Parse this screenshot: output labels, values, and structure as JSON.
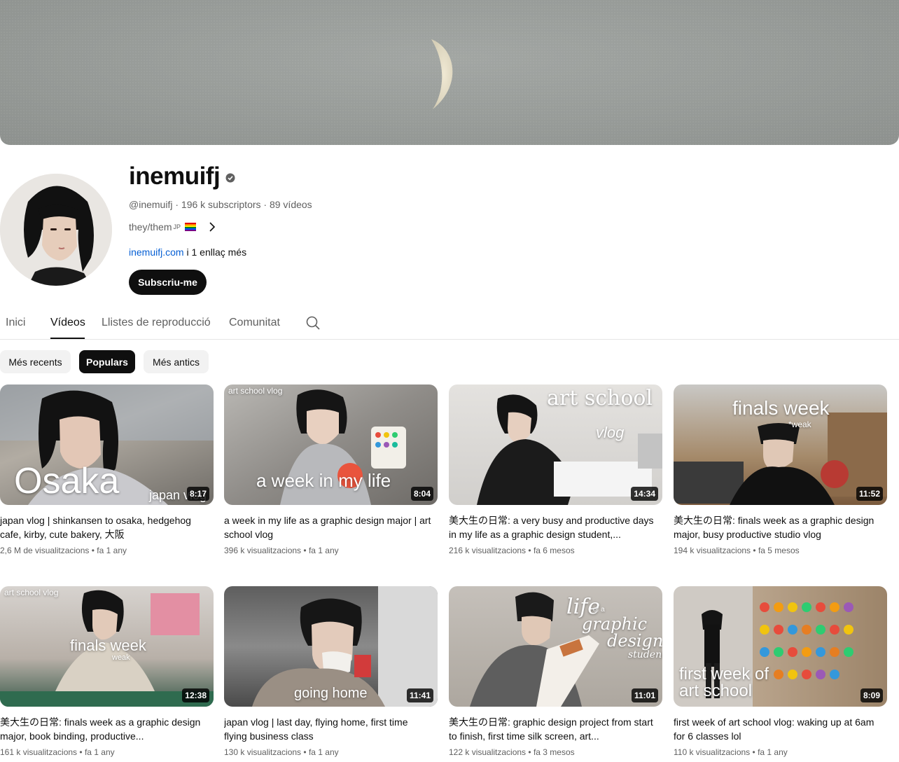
{
  "channel": {
    "name": "inemuifj",
    "handle": "@inemuifj",
    "subscribers": "196 k subscriptors",
    "video_count": "89 vídeos",
    "pronouns": "they/them",
    "pronouns_suffix": "JP",
    "link_text": "inemuifj.com",
    "link_more": " i 1 enllaç més",
    "subscribe_label": "Subscriu-me"
  },
  "tabs": [
    {
      "label": "Inici"
    },
    {
      "label": "Vídeos"
    },
    {
      "label": "Llistes de reproducció"
    },
    {
      "label": "Comunitat"
    }
  ],
  "filters": [
    {
      "label": "Més recents"
    },
    {
      "label": "Populars"
    },
    {
      "label": "Més antics"
    }
  ],
  "videos": [
    {
      "title": "japan vlog | shinkansen to osaka, hedgehog cafe, kirby, cute bakery, 大阪",
      "views": "2,6 M de visualitzacions",
      "age": "fa 1 any",
      "duration": "8:17",
      "overlay": "Osaka",
      "overlay2": "japan vlog"
    },
    {
      "title": "a week in my life as a graphic design major | art school vlog",
      "views": "396 k visualitzacions",
      "age": "fa 1 any",
      "duration": "8:04",
      "overlay": "a week in my life",
      "overlay2": "art school vlog"
    },
    {
      "title": "美大生の日常: a very busy and productive days in my life as a graphic design student,...",
      "views": "216 k visualitzacions",
      "age": "fa 6 mesos",
      "duration": "14:34",
      "overlay": "art school",
      "overlay2": "vlog"
    },
    {
      "title": "美大生の日常: finals week as a graphic design major, busy productive studio vlog",
      "views": "194 k visualitzacions",
      "age": "fa 5 mesos",
      "duration": "11:52",
      "overlay": "finals week",
      "overlay2": "*weak"
    },
    {
      "title": "美大生の日常: finals week as a graphic design major, book binding, productive...",
      "views": "161 k visualitzacions",
      "age": "fa 1 any",
      "duration": "12:38",
      "overlay": "finals week",
      "overlay2": "art school vlog",
      "overlay3": "weak"
    },
    {
      "title": "japan vlog | last day, flying home, first time flying business class",
      "views": "130 k visualitzacions",
      "age": "fa 1 any",
      "duration": "11:41",
      "overlay": "going home"
    },
    {
      "title": "美大生の日常: graphic design project from start to finish, first time silk screen, art...",
      "views": "122 k visualitzacions",
      "age": "fa 3 mesos",
      "duration": "11:01",
      "overlay": "life",
      "overlay2": "of a",
      "overlay3": "graphic",
      "overlay4": "design",
      "overlay5": "student"
    },
    {
      "title": "first week of art school vlog: waking up at 6am for 6 classes lol",
      "views": "110 k visualitzacions",
      "age": "fa 1 any",
      "duration": "8:09",
      "overlay": "first week of",
      "overlay2": "art school"
    }
  ],
  "separator": "•"
}
